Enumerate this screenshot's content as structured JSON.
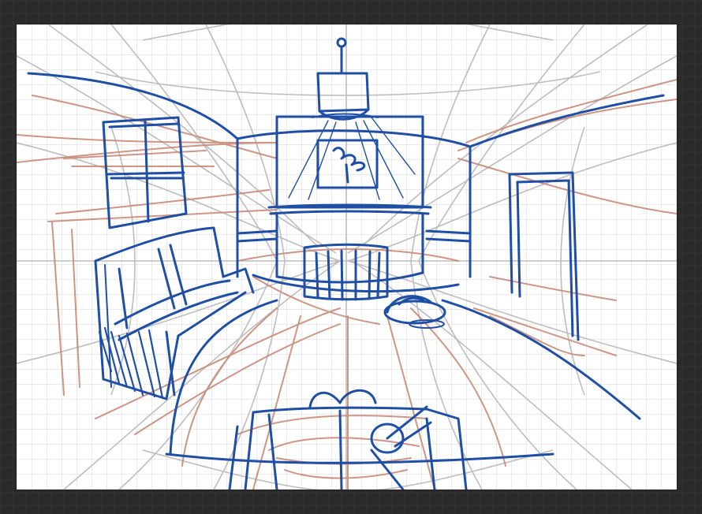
{
  "app": {
    "type": "drawing-canvas",
    "colors": {
      "workspace": "#2b2b2b",
      "paper": "#ffffff",
      "grid": "#d2d2d2",
      "perspective_guides": "#bdbdbd",
      "rough_sketch": "#c98a78",
      "ink": "#1f4fa5"
    }
  },
  "drawing": {
    "subject": "",
    "layers": [
      "grid",
      "perspective-guides",
      "rough-sketch",
      "ink"
    ]
  }
}
